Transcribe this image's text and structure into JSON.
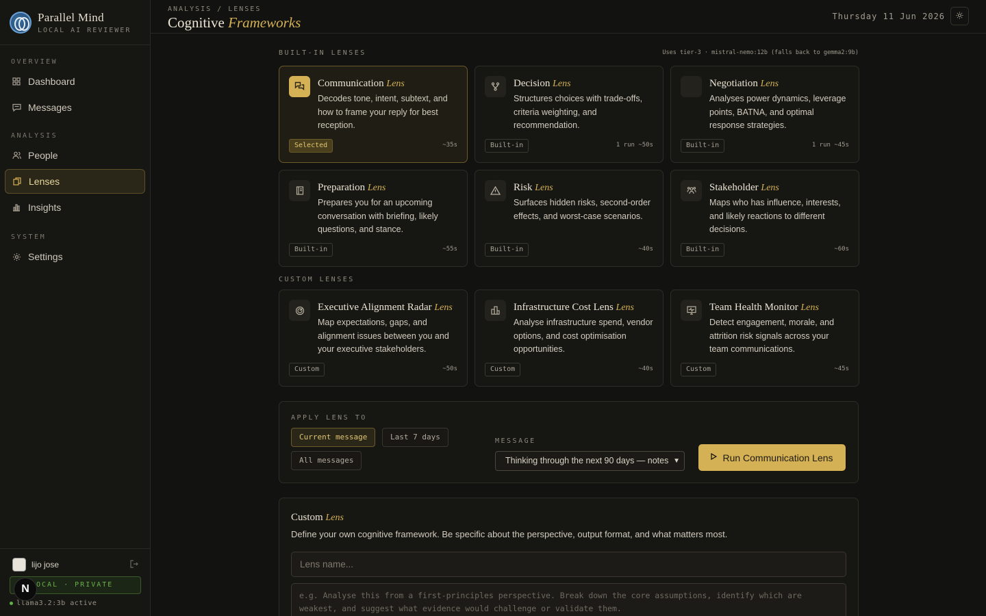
{
  "brand": {
    "name": "Parallel Mind",
    "subtitle": "LOCAL AI REVIEWER"
  },
  "nav": {
    "sections": [
      {
        "label": "OVERVIEW",
        "items": [
          {
            "label": "Dashboard",
            "icon": "grid-icon"
          },
          {
            "label": "Messages",
            "icon": "message-icon"
          }
        ]
      },
      {
        "label": "ANALYSIS",
        "items": [
          {
            "label": "People",
            "icon": "people-icon"
          },
          {
            "label": "Lenses",
            "icon": "layers-icon",
            "active": true
          },
          {
            "label": "Insights",
            "icon": "bar-chart-icon"
          }
        ]
      },
      {
        "label": "SYSTEM",
        "items": [
          {
            "label": "Settings",
            "icon": "gear-icon"
          }
        ]
      }
    ]
  },
  "user": {
    "name": "lijo jose",
    "privacy_badge": "LOCAL · PRIVATE",
    "model_status": "llama3.2:3b active",
    "overlay_badge": "N"
  },
  "header": {
    "breadcrumb": "ANALYSIS / LENSES",
    "title_main": "Cognitive",
    "title_accent": "Frameworks",
    "date": "Thursday 11 Jun 2026"
  },
  "builtin": {
    "label": "BUILT-IN LENSES",
    "tier_note": "Uses tier-3 · mistral-nemo:12b (falls back to gemma2:9b)",
    "cards": [
      {
        "name": "Communication",
        "suffix": "Lens",
        "desc": "Decodes tone, intent, subtext, and how to frame your reply for best reception.",
        "tag": "Selected",
        "meta": "~35s",
        "selected": true,
        "icon": "chat-bubbles-icon"
      },
      {
        "name": "Decision",
        "suffix": "Lens",
        "desc": "Structures choices with trade-offs, criteria weighting, and recommendation.",
        "tag": "Built-in",
        "meta": "1 run  ~50s",
        "icon": "branch-icon"
      },
      {
        "name": "Negotiation",
        "suffix": "Lens",
        "desc": "Analyses power dynamics, leverage points, BATNA, and optimal response strategies.",
        "tag": "Built-in",
        "meta": "1 run  ~45s",
        "icon": "handshake-icon"
      },
      {
        "name": "Preparation",
        "suffix": "Lens",
        "desc": "Prepares you for an upcoming conversation with briefing, likely questions, and stance.",
        "tag": "Built-in",
        "meta": "~55s",
        "icon": "clipboard-icon"
      },
      {
        "name": "Risk",
        "suffix": "Lens",
        "desc": "Surfaces hidden risks, second-order effects, and worst-case scenarios.",
        "tag": "Built-in",
        "meta": "~40s",
        "icon": "warning-icon"
      },
      {
        "name": "Stakeholder",
        "suffix": "Lens",
        "desc": "Maps who has influence, interests, and likely reactions to different decisions.",
        "tag": "Built-in",
        "meta": "~60s",
        "icon": "people-group-icon"
      }
    ]
  },
  "custom": {
    "label": "CUSTOM LENSES",
    "cards": [
      {
        "name": "Executive Alignment Radar",
        "suffix": "Lens",
        "desc": "Map expectations, gaps, and alignment issues between you and your executive stakeholders.",
        "tag": "Custom",
        "meta": "~50s",
        "icon": "radar-icon"
      },
      {
        "name": "Infrastructure Cost Lens",
        "suffix": "Lens",
        "desc": "Analyse infrastructure spend, vendor options, and cost optimisation opportunities.",
        "tag": "Custom",
        "meta": "~40s",
        "icon": "building-icon"
      },
      {
        "name": "Team Health Monitor",
        "suffix": "Lens",
        "desc": "Detect engagement, morale, and attrition risk signals across your team communications.",
        "tag": "Custom",
        "meta": "~45s",
        "icon": "monitor-heart-icon"
      }
    ]
  },
  "apply": {
    "label": "APPLY LENS TO",
    "scopes": [
      "Current message",
      "Last 7 days",
      "All messages"
    ],
    "active_scope": "Current message",
    "message_label": "MESSAGE",
    "message_selected": "Thinking through the next 90 days — notes",
    "run_label": "Run Communication Lens"
  },
  "custom_form": {
    "title": "Custom",
    "title_accent": "Lens",
    "desc": "Define your own cognitive framework. Be specific about the perspective, output format, and what matters most.",
    "name_placeholder": "Lens name...",
    "prompt_placeholder": "e.g. Analyse this from a first-principles perspective. Break down the core assumptions, identify which are weakest, and suggest what evidence would challenge or validate them."
  }
}
